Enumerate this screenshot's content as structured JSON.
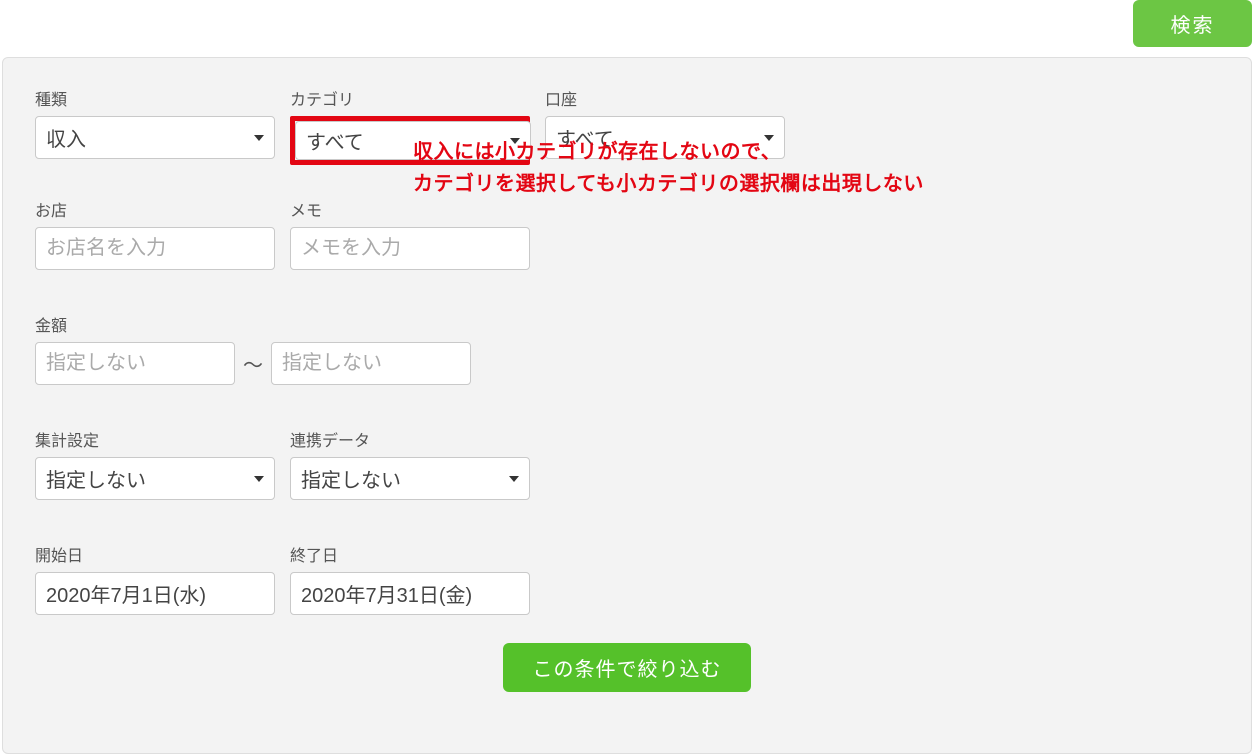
{
  "top": {
    "search_button": "検索"
  },
  "row1": {
    "type_label": "種類",
    "type_value": "収入",
    "category_label": "カテゴリ",
    "category_value": "すべて",
    "account_label": "口座",
    "account_value": "すべて"
  },
  "annotation": {
    "line1": "収入には小カテゴリが存在しないので、",
    "line2": "カテゴリを選択しても小カテゴリの選択欄は出現しない"
  },
  "row2": {
    "shop_label": "お店",
    "shop_placeholder": "お店名を入力",
    "memo_label": "メモ",
    "memo_placeholder": "メモを入力"
  },
  "row3": {
    "amount_label": "金額",
    "amount_from_placeholder": "指定しない",
    "amount_to_placeholder": "指定しない",
    "tilde": "〜"
  },
  "row4": {
    "aggregation_label": "集計設定",
    "aggregation_value": "指定しない",
    "linked_label": "連携データ",
    "linked_value": "指定しない"
  },
  "row5": {
    "start_label": "開始日",
    "start_value": "2020年7月1日(水)",
    "end_label": "終了日",
    "end_value": "2020年7月31日(金)"
  },
  "submit": {
    "label": "この条件で絞り込む"
  },
  "colors": {
    "accent_green": "#55c12a",
    "search_green": "#6cc644",
    "highlight_red": "#e30613"
  }
}
